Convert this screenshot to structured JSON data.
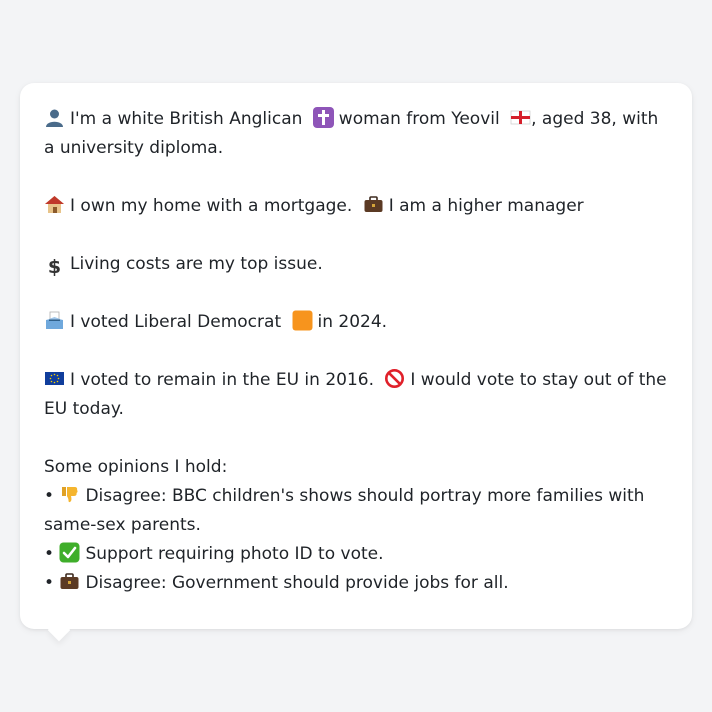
{
  "bio": {
    "identity": {
      "icon": "person-silhouette-icon",
      "text1": "I'm a white British Anglican",
      "religion_icon": "latin-cross-icon",
      "text2": "woman from Yeovil",
      "flag_icon": "england-flag-icon",
      "text3": ", aged 38, with a university diploma."
    },
    "home": {
      "icon": "house-icon",
      "text1": "I own my home with a mortgage.",
      "job_icon": "briefcase-icon",
      "text2": "I am a higher manager"
    },
    "issue": {
      "icon": "dollar-sign-icon",
      "text": "Living costs are my top issue."
    },
    "vote": {
      "icon": "ballot-box-icon",
      "text1": "I voted Liberal Democrat",
      "party_icon": "orange-square-icon",
      "text2": "in 2024."
    },
    "eu": {
      "icon": "eu-flag-icon",
      "text1": "I voted to remain in the EU in 2016.",
      "stance_icon": "prohibited-icon",
      "text2": "I would vote to stay out of the EU today."
    },
    "opinions": {
      "heading": "Some opinions I hold:",
      "bullet": "•",
      "items": [
        {
          "icon": "thumbs-down-icon",
          "text": "Disagree: BBC children's shows should portray more families with same-sex parents."
        },
        {
          "icon": "check-mark-button-icon",
          "text": "Support requiring photo ID to vote."
        },
        {
          "icon": "briefcase-icon",
          "text": "Disagree: Government should provide jobs for all."
        }
      ]
    }
  },
  "colors": {
    "background": "#f3f4f6",
    "card": "#ffffff",
    "text": "#1f2328"
  }
}
